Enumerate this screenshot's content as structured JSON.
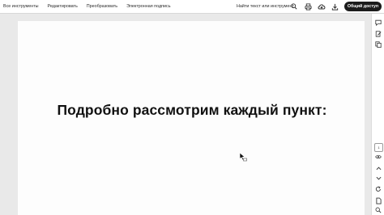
{
  "toolbar": {
    "menu": [
      "Все инструменты",
      "Редактировать",
      "Преобразовать",
      "Электронная подпись"
    ],
    "search_label": "Найти текст или инструмент",
    "share_label": "Общий доступ",
    "icons": [
      "search-icon",
      "print-icon",
      "cloud-upload-icon",
      "download-icon"
    ]
  },
  "document": {
    "heading": "Подробно рассмотрим каждый пункт:"
  },
  "sidebar": {
    "icons": [
      "comment-icon",
      "edit-pages-icon",
      "copy-icon",
      "page-indicator",
      "view-icon",
      "chevron-up-icon",
      "chevron-down-icon",
      "rotate-icon",
      "file-icon",
      "zoom-icon"
    ],
    "page_number": "1"
  },
  "colors": {
    "share_button_bg": "#1c1c1c",
    "document_background": "#e9e9e9",
    "page_background": "#fdfdfd"
  }
}
